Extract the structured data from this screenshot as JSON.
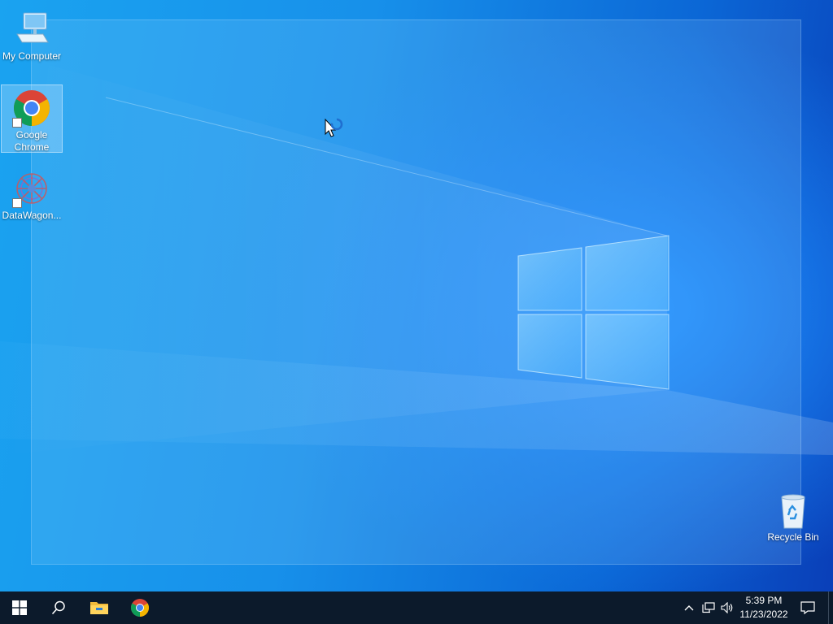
{
  "desktop": {
    "icons": [
      {
        "label": "My Computer",
        "icon": "computer-icon"
      },
      {
        "label": "Google Chrome",
        "icon": "chrome-icon",
        "selected": true
      },
      {
        "label": "DataWagon...",
        "icon": "datawagon-icon"
      },
      {
        "label": "Recycle Bin",
        "icon": "recycle-bin-icon"
      }
    ]
  },
  "taskbar": {
    "start": "windows-start-icon",
    "search": "search-icon",
    "pinned": [
      "file-explorer-icon",
      "chrome-icon"
    ],
    "tray": [
      "chevron-up-icon",
      "network-icon",
      "volume-icon",
      "notification-icon"
    ],
    "clock": {
      "time": "5:39 PM",
      "date": "11/23/2022"
    }
  },
  "colors": {
    "taskbar": "#0c1a2b",
    "wallpaper_primary": "#1790ea",
    "wallpaper_dark": "#0a3fb8"
  }
}
